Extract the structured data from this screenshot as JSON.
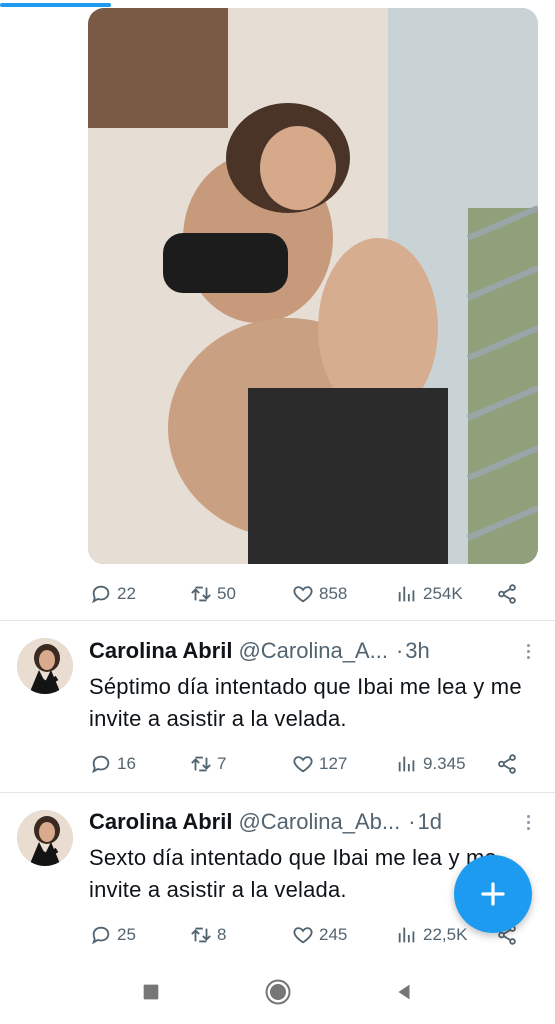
{
  "top_progress": {
    "percent": 20
  },
  "tweets": [
    {
      "reply_count": "22",
      "retweet_count": "50",
      "like_count": "858",
      "view_count": "254K"
    },
    {
      "author_name": "Carolina Abril",
      "handle": "@Carolina_A...",
      "time_separator": "·",
      "time": "3h",
      "text": "Séptimo día intentado que Ibai me lea y me invite a asistir a la velada.",
      "reply_count": "16",
      "retweet_count": "7",
      "like_count": "127",
      "view_count": "9.345"
    },
    {
      "author_name": "Carolina Abril",
      "handle": "@Carolina_Ab...",
      "time_separator": "·",
      "time": "1d",
      "text": "Sexto día intentado que Ibai me lea y me invite a asistir a la velada.",
      "reply_count": "25",
      "retweet_count": "8",
      "like_count": "245",
      "view_count": "22,5K"
    }
  ],
  "icons": {
    "reply": "speech-bubble-icon",
    "retweet": "retweet-arrows-icon",
    "like": "heart-icon",
    "views": "bar-chart-icon",
    "share": "share-nodes-icon",
    "compose": "plus-icon",
    "nav_recents": "square-icon",
    "nav_home": "circle-icon",
    "nav_back": "triangle-back-icon"
  },
  "colors": {
    "accent": "#1d9bf0",
    "text_primary": "#0f1419",
    "text_secondary": "#536471"
  }
}
